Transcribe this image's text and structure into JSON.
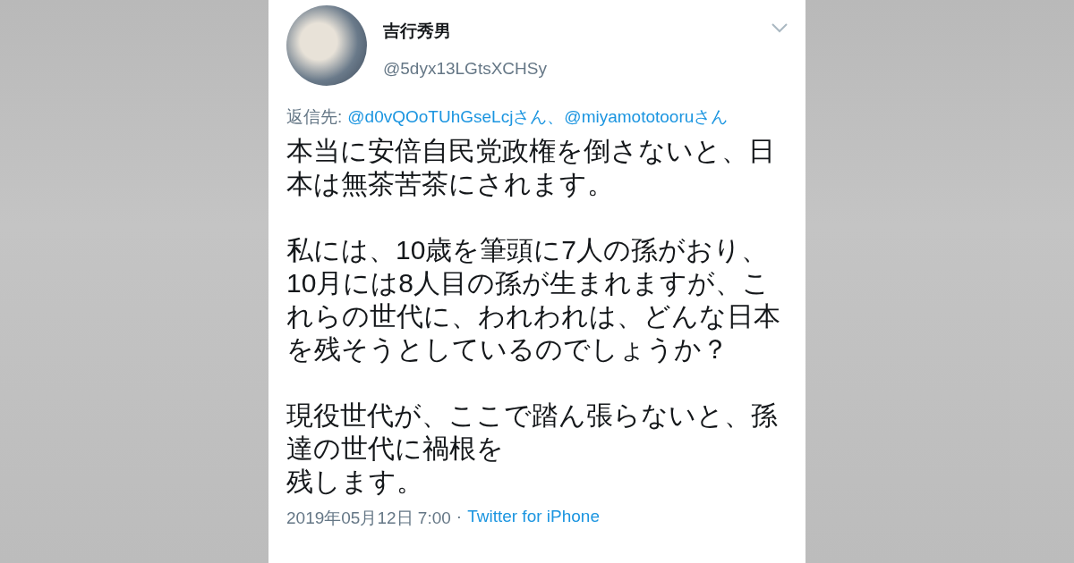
{
  "tweet": {
    "name": "吉行秀男",
    "handle": "@5dyx13LGtsXCHSy",
    "reply": {
      "label": "返信先:",
      "mentions": [
        "@d0vQOoTUhGseLcjさん",
        "@miyamototooruさん"
      ],
      "separator": "、"
    },
    "paragraphs": [
      [
        "本当に安倍自民党政権を倒さないと、日",
        "本は無茶苦茶にされます。"
      ],
      [
        "私には、10歳を筆頭に7人の孫がおり、",
        "10月には8人目の孫が生まれますが、こ",
        "れらの世代に、われわれは、どんな日本",
        "を残そうとしているのでしょうか？"
      ],
      [
        "現役世代が、ここで踏ん張らないと、孫",
        "達の世代に禍根を",
        "残します。"
      ]
    ],
    "timestamp": "2019年05月12日 7:00",
    "dot": "·",
    "source": "Twitter for iPhone"
  }
}
